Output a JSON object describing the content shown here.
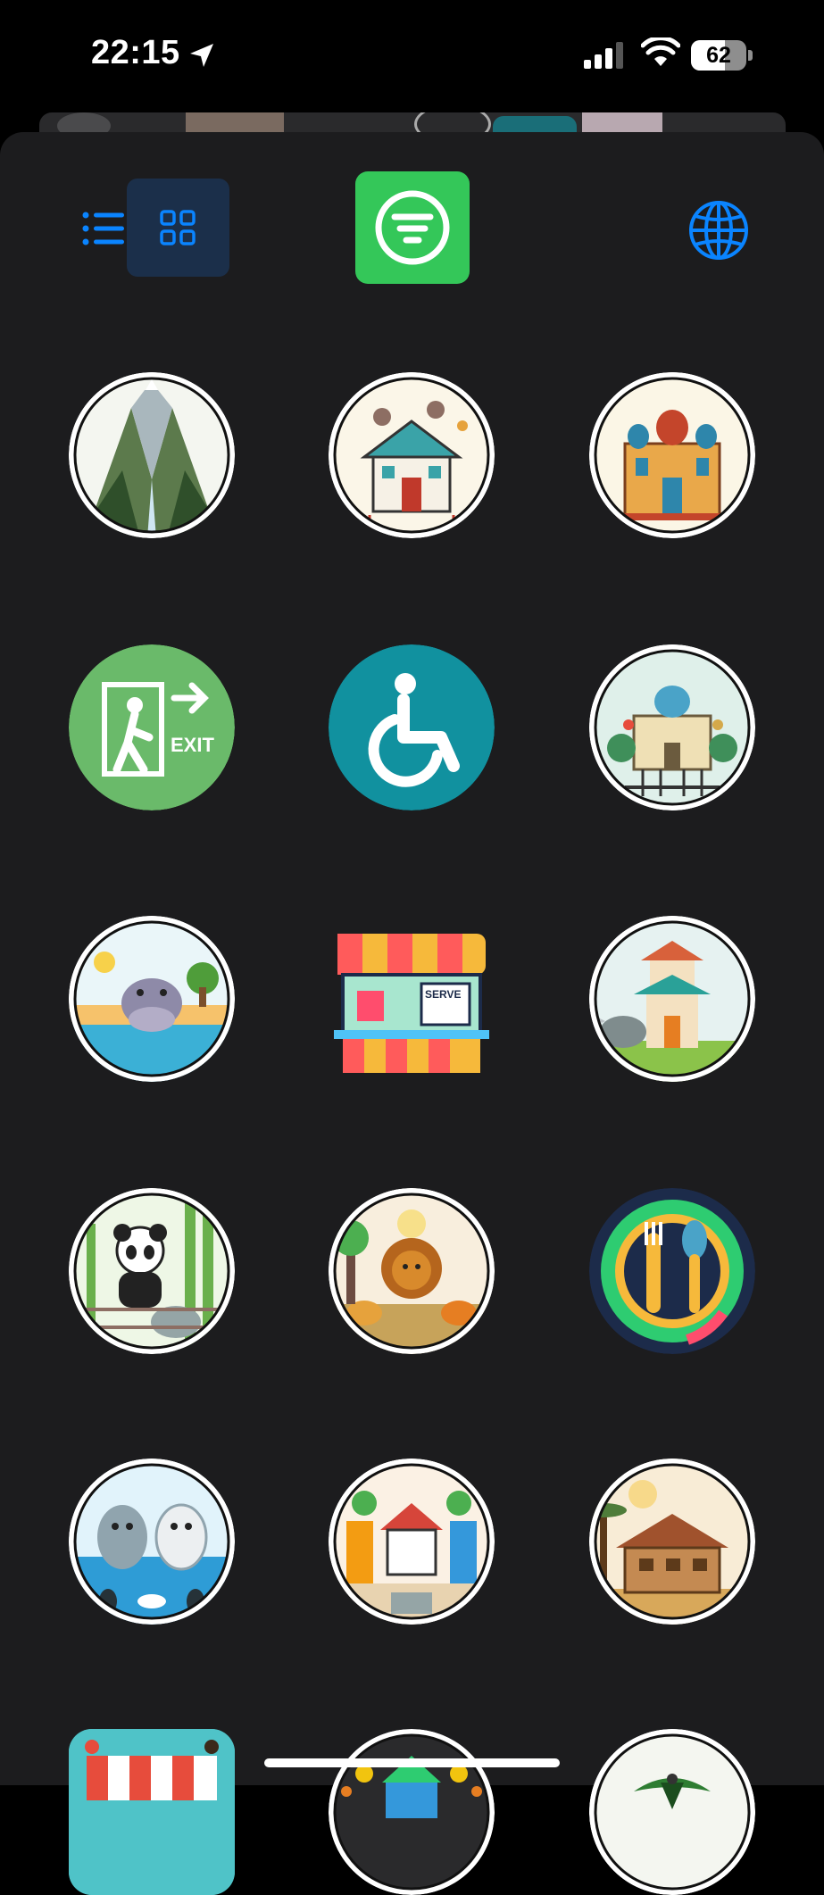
{
  "status_bar": {
    "time": "22:15",
    "battery_level": "62",
    "battery_fraction": 0.62
  },
  "toolbar": {
    "list_view_icon": "list-icon",
    "grid_view_icon": "grid-icon",
    "filter_icon": "filter-icon",
    "language_icon": "globe-icon",
    "active_view": "grid",
    "accent_color": "#0a84ff",
    "filter_color": "#34c759"
  },
  "grid": {
    "items": [
      {
        "icon": "canyon-waterfall-icon",
        "bg": "#f4f6f0",
        "accent": "#4f7d3a"
      },
      {
        "icon": "monkey-house-icon",
        "bg": "#fbf6e8",
        "accent": "#3aa3a8"
      },
      {
        "icon": "palace-building-icon",
        "bg": "#fbf6e6",
        "accent": "#c4452b"
      },
      {
        "icon": "exit-sign-icon",
        "bg": "#6aba6a",
        "accent": "#ffffff"
      },
      {
        "icon": "wheelchair-icon",
        "bg": "#11919f",
        "accent": "#ffffff"
      },
      {
        "icon": "aviary-palace-icon",
        "bg": "#dff0ea",
        "accent": "#d4a94a"
      },
      {
        "icon": "hippo-pool-icon",
        "bg": "#eaf6f9",
        "accent": "#8e8aa8"
      },
      {
        "icon": "food-kiosk-icon",
        "bg": "#1c1c1e",
        "accent": "#ff5b5b"
      },
      {
        "icon": "pagoda-rhino-icon",
        "bg": "#e6f2f1",
        "accent": "#d8613b"
      },
      {
        "icon": "panda-bamboo-icon",
        "bg": "#eef7e6",
        "accent": "#6ab04c"
      },
      {
        "icon": "lion-savanna-icon",
        "bg": "#f8eedd",
        "accent": "#d88a2c"
      },
      {
        "icon": "restaurant-cutlery-icon",
        "bg": "#1c2b4a",
        "accent": "#f6b93b"
      },
      {
        "icon": "seal-penguin-icon",
        "bg": "#e1f3fb",
        "accent": "#2e9cd6"
      },
      {
        "icon": "plaza-carousel-icon",
        "bg": "#fbf1e4",
        "accent": "#d6453a"
      },
      {
        "icon": "safari-lodge-icon",
        "bg": "#f8ecd6",
        "accent": "#a0522d"
      },
      {
        "icon": "paw-shop-icon",
        "bg": "#4fc3c8",
        "accent": "#e74c3c"
      },
      {
        "icon": "zoo-entrance-icon",
        "bg": "#2a2a2c",
        "accent": "#f1c40f"
      },
      {
        "icon": "bird-icon",
        "bg": "#f4f6f0",
        "accent": "#2e7d32"
      }
    ]
  }
}
